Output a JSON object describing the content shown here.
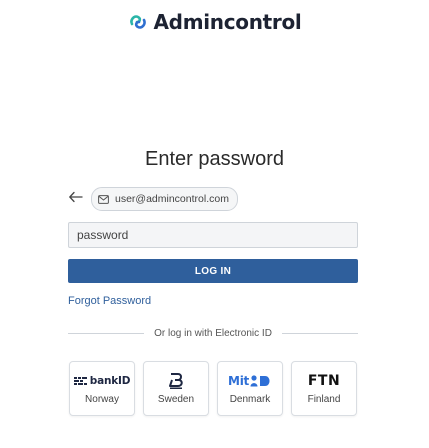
{
  "brand": {
    "name": "Admincontrol",
    "colors": {
      "primary": "#2f5f9c",
      "logo_text": "#1d2333",
      "logo_teal": "#2bb5a8",
      "logo_blue": "#2f6fd0"
    }
  },
  "page": {
    "heading": "Enter password"
  },
  "account": {
    "email": "user@admincontrol.com",
    "back_icon": "arrow-left-icon",
    "email_icon": "mail-icon"
  },
  "form": {
    "password_placeholder": "password",
    "password_value": "",
    "login_label": "LOG IN",
    "forgot_label": "Forgot Password"
  },
  "electronic_id": {
    "divider_text": "Or log in with Electronic ID",
    "providers": [
      {
        "name": "Norway",
        "logo_text": "bankID",
        "icon": "bankid-norway-icon"
      },
      {
        "name": "Sweden",
        "logo_text": "",
        "icon": "bankid-sweden-icon"
      },
      {
        "name": "Denmark",
        "logo_text": "Mit",
        "icon": "mitid-icon"
      },
      {
        "name": "Finland",
        "logo_text": "FTN",
        "icon": "ftn-icon"
      }
    ]
  }
}
